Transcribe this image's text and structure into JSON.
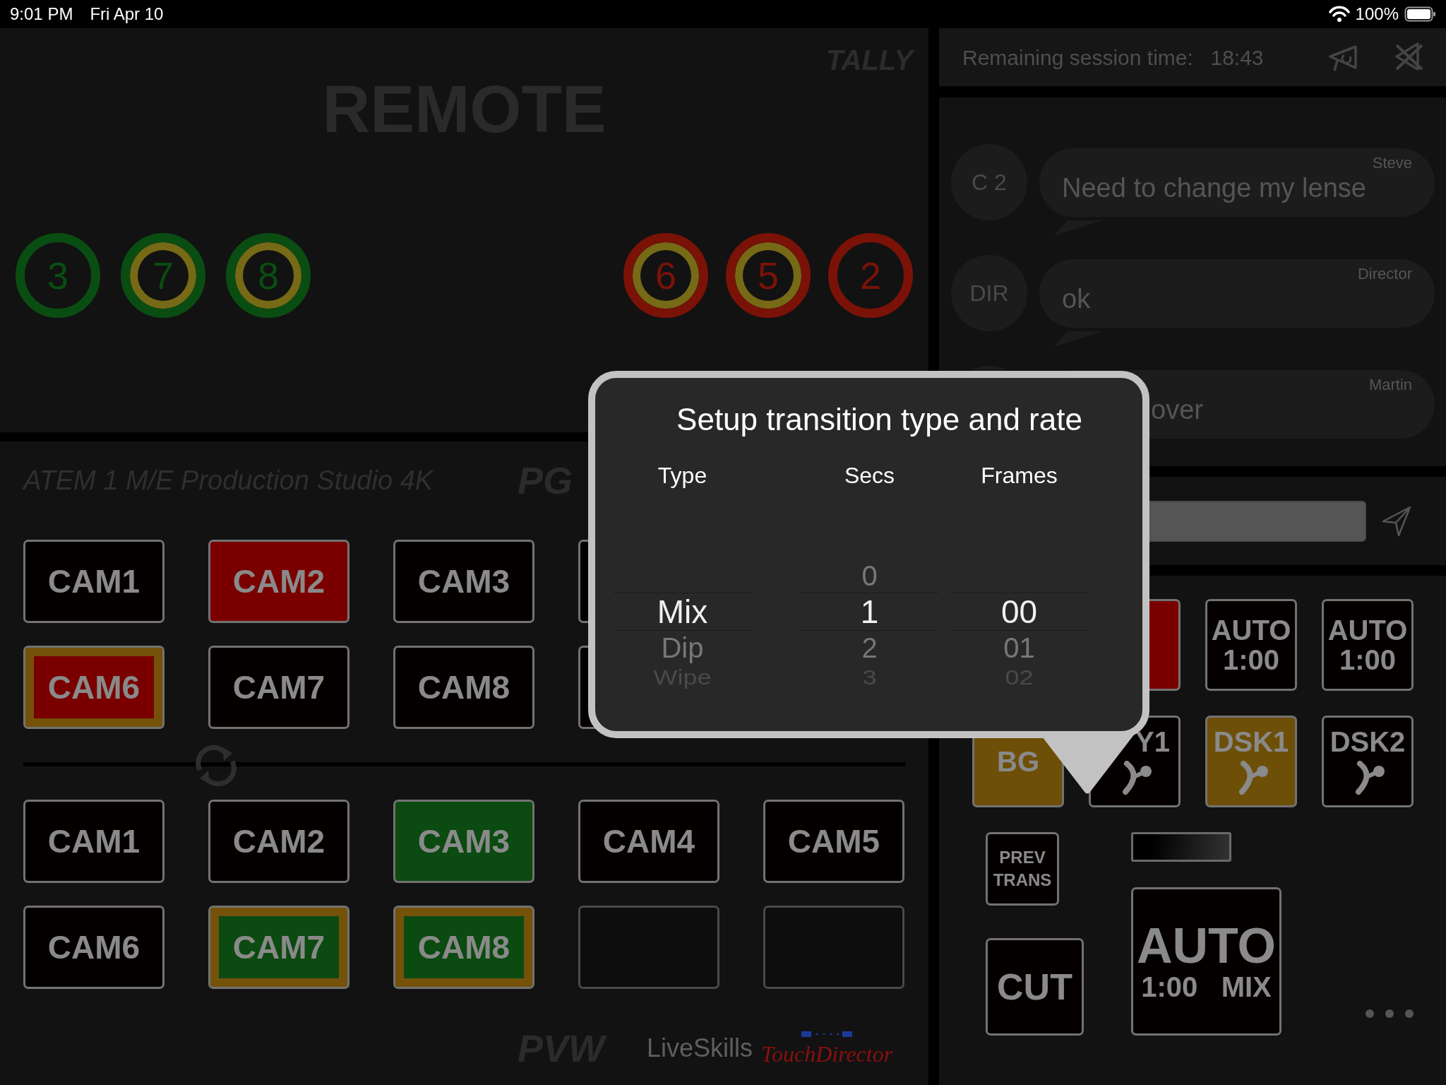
{
  "status_bar": {
    "time": "9:01 PM",
    "date": "Fri Apr 10",
    "battery": "100%"
  },
  "tally": {
    "label": "TALLY",
    "title": "REMOTE",
    "preview": [
      {
        "number": "3",
        "color": "#0a4d12",
        "transition": false
      },
      {
        "number": "7",
        "color": "#0a4d12",
        "transition": true
      },
      {
        "number": "8",
        "color": "#0a4d12",
        "transition": true
      }
    ],
    "program": [
      {
        "number": "6",
        "color": "#7a1208",
        "transition": true
      },
      {
        "number": "5",
        "color": "#7a1208",
        "transition": true
      },
      {
        "number": "2",
        "color": "#7a1208",
        "transition": false
      }
    ]
  },
  "switcher": {
    "model": "ATEM 1 M/E Production Studio 4K",
    "program_label": "PG",
    "preview_label": "PVW",
    "program_rows": [
      [
        {
          "kind": "button",
          "label": "CAM1",
          "selected": false,
          "transition": false
        },
        {
          "kind": "button",
          "label": "CAM2",
          "selected": true,
          "transition": false
        },
        {
          "kind": "button",
          "label": "CAM3",
          "selected": false,
          "transition": false
        },
        {
          "kind": "button",
          "selected": false,
          "transition": false
        }
      ],
      [
        {
          "kind": "button",
          "label": "CAM6",
          "selected": true,
          "transition": true
        },
        {
          "kind": "button",
          "label": "CAM7",
          "selected": false,
          "transition": false
        },
        {
          "kind": "button",
          "label": "CAM8",
          "selected": false,
          "transition": false
        },
        {
          "kind": "button",
          "selected": false,
          "transition": false
        }
      ]
    ],
    "preview_rows": [
      [
        {
          "kind": "button",
          "label": "CAM1",
          "selected": false,
          "transition": false
        },
        {
          "kind": "button",
          "label": "CAM2",
          "selected": false,
          "transition": false
        },
        {
          "kind": "button",
          "label": "CAM3",
          "selected": true,
          "transition": false
        },
        {
          "kind": "button",
          "label": "CAM4",
          "selected": false,
          "transition": false
        },
        {
          "kind": "button",
          "label": "CAM5",
          "selected": false,
          "transition": false
        }
      ],
      [
        {
          "kind": "button",
          "label": "CAM6",
          "selected": false,
          "transition": false
        },
        {
          "kind": "button",
          "label": "CAM7",
          "selected": true,
          "transition": true
        },
        {
          "kind": "button",
          "label": "CAM8",
          "selected": true,
          "transition": true
        },
        {
          "kind": "empty"
        },
        {
          "kind": "empty"
        }
      ]
    ]
  },
  "footer": {
    "brand": "LiveSkills",
    "product": "TouchDirector"
  },
  "session": {
    "label": "Remaining session time:",
    "time": "18:43"
  },
  "chat": {
    "messages": [
      {
        "avatar": "C 2",
        "sender": "Steve",
        "text": "Need to change my lense",
        "covered": false
      },
      {
        "avatar": "DIR",
        "sender": "Director",
        "text": "ok",
        "covered": false
      },
      {
        "sender": "Martin",
        "text": "over",
        "covered": true
      }
    ]
  },
  "keys": [
    [
      {
        "on_air": true,
        "keyer": false
      },
      {
        "lines": [
          "AUTO",
          "1:00"
        ],
        "on_air": false,
        "on": false,
        "keyer": false
      },
      {
        "lines": [
          "AUTO",
          "1:00"
        ],
        "on_air": false,
        "on": false,
        "keyer": false
      }
    ],
    [
      {
        "lines": [
          "BG"
        ],
        "on_air": false,
        "on": true,
        "keyer": false
      },
      {
        "lines": [
          "Y1"
        ],
        "covered": true,
        "on_air": false,
        "on": false,
        "keyer": true
      },
      {
        "lines": [
          "DSK1"
        ],
        "on_air": false,
        "on": true,
        "keyer": true
      },
      {
        "lines": [
          "DSK2"
        ],
        "on_air": false,
        "on": false,
        "keyer": true
      }
    ]
  ],
  "transition": {
    "prev_trans": [
      "PREV",
      "TRANS"
    ],
    "cut": "CUT",
    "auto": {
      "title": "AUTO",
      "rate": "1:00",
      "type": "MIX"
    }
  },
  "popup": {
    "title": "Setup transition type and rate",
    "pickers": [
      {
        "heading": "Type",
        "options": [
          {
            "text": "Mix",
            "selected": true
          },
          {
            "text": "Dip",
            "selected": false
          },
          {
            "text": "Wipe",
            "selected": false
          }
        ]
      },
      {
        "heading": "Secs",
        "options": [
          {
            "text": "0",
            "selected": false
          },
          {
            "text": "1",
            "selected": true
          },
          {
            "text": "2",
            "selected": false
          },
          {
            "text": "3",
            "selected": false
          }
        ]
      },
      {
        "heading": "Frames",
        "options": [
          {
            "text": "00",
            "selected": true
          },
          {
            "text": "01",
            "selected": false
          },
          {
            "text": "02",
            "selected": false
          }
        ]
      }
    ]
  }
}
